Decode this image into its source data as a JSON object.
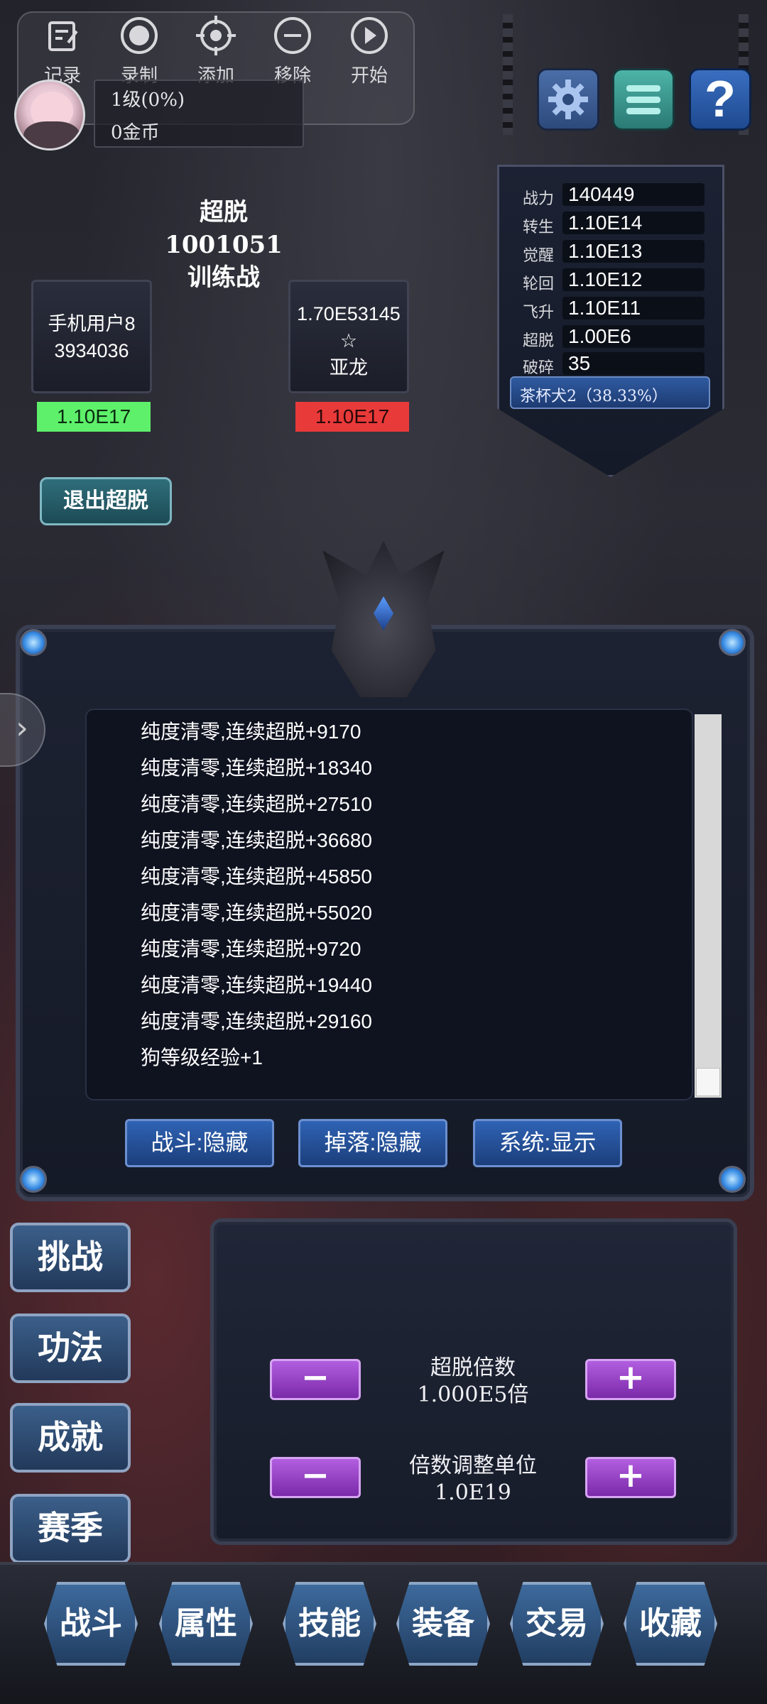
{
  "recorder": {
    "items": [
      {
        "icon": "edit-icon",
        "label": "记录"
      },
      {
        "icon": "record-icon",
        "label": "录制"
      },
      {
        "icon": "target-icon",
        "label": "添加"
      },
      {
        "icon": "minus-circle-icon",
        "label": "移除"
      },
      {
        "icon": "play-icon",
        "label": "开始"
      }
    ]
  },
  "player": {
    "level": "1级(0%)",
    "gold": "0金币"
  },
  "top_buttons": {
    "help_label": "?"
  },
  "stats": {
    "rows": [
      {
        "label": "战力",
        "value": "140449"
      },
      {
        "label": "转生",
        "value": "1.10E14"
      },
      {
        "label": "觉醒",
        "value": "1.10E13"
      },
      {
        "label": "轮回",
        "value": "1.10E12"
      },
      {
        "label": "飞升",
        "value": "1.10E11"
      },
      {
        "label": "超脱",
        "value": "1.00E6"
      },
      {
        "label": "破碎",
        "value": "35"
      }
    ],
    "pet": "茶杯犬2（38.33%）"
  },
  "battle": {
    "title_line1": "超脱1001051",
    "title_line2": "训练战",
    "player_name_line1": "手机用户8",
    "player_name_line2": "3934036",
    "player_hp": "1.10E17",
    "enemy_power": "1.70E53145",
    "enemy_star": "☆",
    "enemy_name": "亚龙",
    "enemy_hp": "1.10E17",
    "exit_label": "退出超脱"
  },
  "log": {
    "lines": [
      "纯度清零,连续超脱+9170",
      "纯度清零,连续超脱+18340",
      "纯度清零,连续超脱+27510",
      "纯度清零,连续超脱+36680",
      "纯度清零,连续超脱+45850",
      "纯度清零,连续超脱+55020",
      "纯度清零,连续超脱+9720",
      "纯度清零,连续超脱+19440",
      "纯度清零,连续超脱+29160",
      "狗等级经验+1"
    ],
    "filters": [
      {
        "label": "战斗:隐藏"
      },
      {
        "label": "掉落:隐藏"
      },
      {
        "label": "系统:显示"
      }
    ],
    "side_tab": "›"
  },
  "side_actions": [
    "挑战",
    "功法",
    "成就",
    "赛季"
  ],
  "multiplier": {
    "rate_label": "超脱倍数",
    "rate_value": "1.000E5倍",
    "unit_label": "倍数调整单位",
    "unit_value": "1.0E19",
    "minus": "−",
    "plus": "+"
  },
  "bottom_nav": [
    "战斗",
    "属性",
    "技能",
    "装备",
    "交易",
    "收藏"
  ],
  "colors": {
    "player_hp": "#5ef06a",
    "enemy_hp": "#e93a3a",
    "accent_purple": "#9a46c8",
    "accent_blue": "#2f63b4"
  }
}
